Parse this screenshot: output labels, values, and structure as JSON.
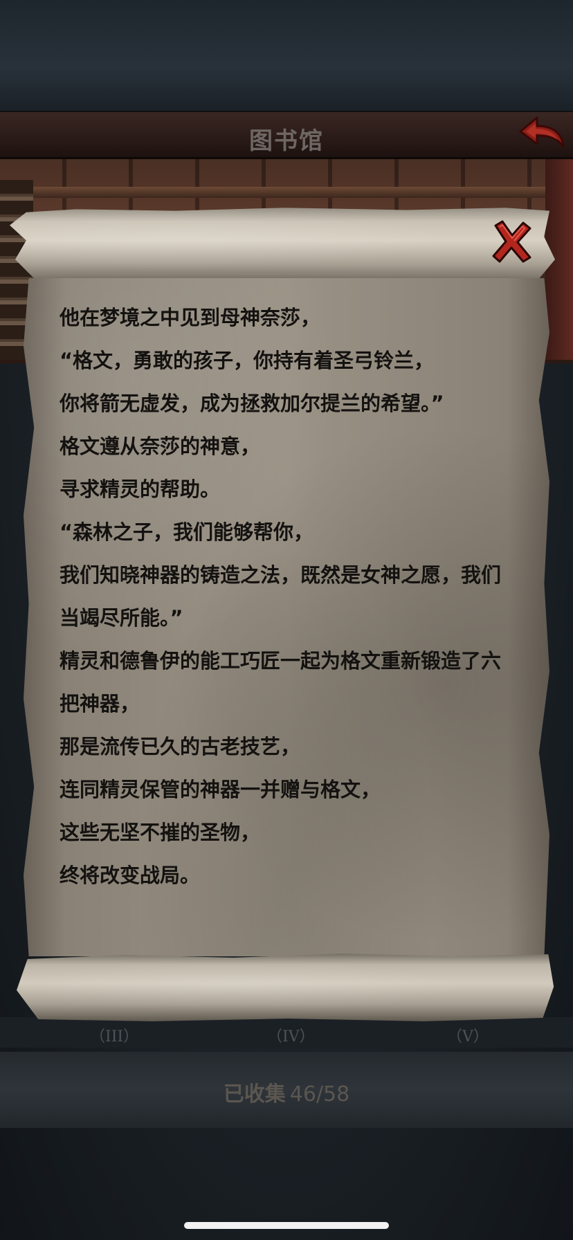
{
  "header": {
    "title": "图书馆"
  },
  "scroll": {
    "lines": [
      "他在梦境之中见到母神奈莎，",
      "“格文，勇敢的孩子，你持有着圣弓铃兰，",
      "你将箭无虚发，成为拯救加尔提兰的希望。”",
      "格文遵从奈莎的神意，",
      "寻求精灵的帮助。",
      "“森林之子，我们能够帮你，",
      "我们知晓神器的铸造之法，既然是女神之愿，我们",
      "当竭尽所能。”",
      "精灵和德鲁伊的能工巧匠一起为格文重新锻造了六",
      "把神器，",
      "那是流传已久的古老技艺，",
      "连同精灵保管的神器一并赠与格文，",
      "这些无坚不摧的圣物，",
      "终将改变战局。"
    ]
  },
  "gallery": {
    "labels": [
      "（III）",
      "（IV）",
      "（V）"
    ]
  },
  "footer": {
    "collected_label": "已收集",
    "collected_count": "46/58"
  },
  "colors": {
    "accent_red": "#b3261e",
    "title_text": "#6e6663",
    "scroll_text": "#141210"
  },
  "icons": {
    "back": "back-arrow-icon",
    "close": "close-x-icon"
  }
}
